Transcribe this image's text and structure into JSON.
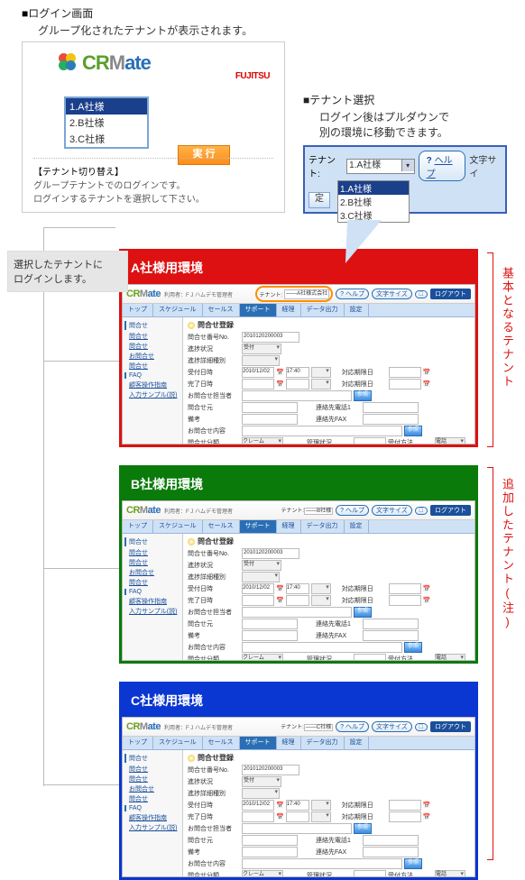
{
  "login": {
    "heading_prefix": "■",
    "heading": "ログイン画面",
    "subheading": "グループ化されたテナントが表示されます。",
    "brand_pre": "CR",
    "brand_m": "M",
    "brand_post": "ate",
    "fujitsu": "FUJITSU",
    "tenants": [
      "1.A社様",
      "2.B社様",
      "3.C社様"
    ],
    "exec": "実 行",
    "note_title": "【テナント切り替え】",
    "note_line1": "グループテナントでのログインです。",
    "note_line2": "ログインするテナントを選択して下さい。"
  },
  "tswitch": {
    "heading_prefix": "■",
    "heading": "テナント選択",
    "sub_line1": "ログイン後はプルダウンで",
    "sub_line2": "別の環境に移動できます。",
    "label": "テナント:",
    "selected": "1.A社様",
    "options": [
      "1.A社様",
      "2.B社様",
      "3.C社様"
    ],
    "help_q": "?",
    "help": "ヘルプ",
    "textsize": "文字サイ",
    "tei": "定"
  },
  "callout1": {
    "line1": "選択したテナントに",
    "line2": "ログインします。"
  },
  "right": {
    "top": "基本となるテナント",
    "bottom": "追加したテナント(注)"
  },
  "env": {
    "a_title": "A社様用環境",
    "b_title": "B社様用環境",
    "c_title": "C社様用環境"
  },
  "app": {
    "brand_pre": "CR",
    "brand_m": "M",
    "brand_post": "ate",
    "user_label": "利用者：F J ハムデモ管理者",
    "tenant_label": "テナント:",
    "tenant_val_a": "――A社様式会社",
    "tenant_val_b": "――B社様",
    "tenant_val_c": "――C社様",
    "help": "ヘルプ",
    "textsize": "文字サイズ",
    "fit": "□",
    "logout": "ログアウト",
    "menus": [
      "トップ",
      "スケジュール",
      "セールス",
      "サポート",
      "経理",
      "データ出力",
      "設定"
    ],
    "side_groups": [
      {
        "title": "問合せ",
        "links": [
          "問合せ",
          "問合せ",
          "お問合せ",
          "問合せ"
        ]
      },
      {
        "title": "FAQ",
        "links": [
          "顧客操作指南",
          "入力サンプル(説)"
        ]
      }
    ],
    "form_title": "問合せ登録",
    "labels": {
      "no": "問合せ番号No.",
      "no_val": "2010120200003",
      "status": "進捗状況",
      "status_val": "受付",
      "kubun": "進捗詳細種別",
      "kubun_val": "",
      "accept_date": "受付日時",
      "accept_date_val": "2010/12/02",
      "accept_time": "17:40",
      "respond_date": "対応期限日",
      "done_date": "完了日時",
      "handler": "お問合せ担当者",
      "ref": "参照",
      "from": "問合せ元",
      "phone": "連絡先電話1",
      "fax": "連絡先FAX",
      "note": "備考",
      "contact": "お問合せ内容",
      "category": "問合せ分類",
      "cat_val": "クレーム",
      "tanto": "管理状況",
      "method": "受付方法",
      "method_val": "電話"
    }
  }
}
